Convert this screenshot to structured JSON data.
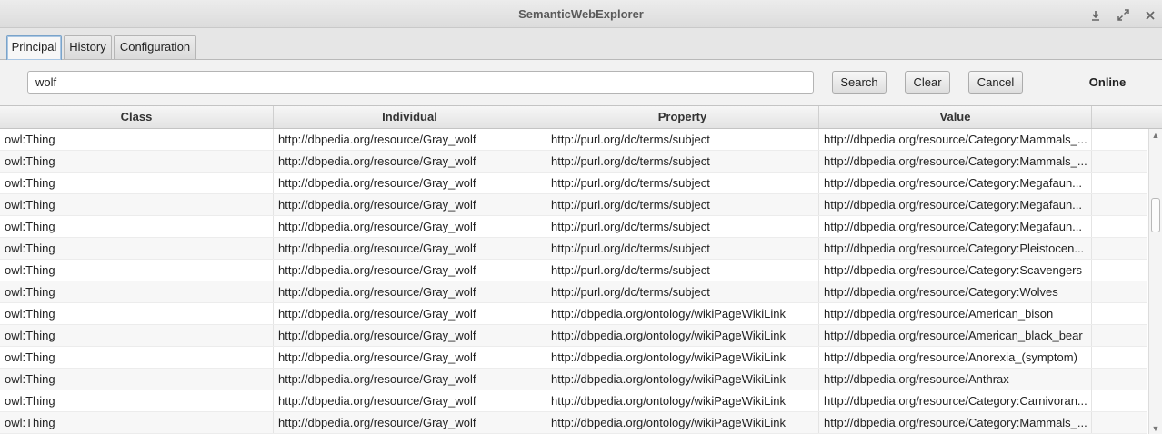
{
  "window": {
    "title": "SemanticWebExplorer",
    "controls": [
      "download-icon",
      "maximize-icon",
      "close-icon"
    ]
  },
  "tabs": [
    {
      "label": "Principal",
      "active": true
    },
    {
      "label": "History",
      "active": false
    },
    {
      "label": "Configuration",
      "active": false
    }
  ],
  "search": {
    "value": "wolf",
    "placeholder": ""
  },
  "buttons": {
    "search": "Search",
    "clear": "Clear",
    "cancel": "Cancel"
  },
  "status": "Online",
  "table": {
    "columns": [
      "Class",
      "Individual",
      "Property",
      "Value"
    ],
    "rows": [
      [
        "owl:Thing",
        "http://dbpedia.org/resource/Gray_wolf",
        "http://purl.org/dc/terms/subject",
        "http://dbpedia.org/resource/Category:Mammals_..."
      ],
      [
        "owl:Thing",
        "http://dbpedia.org/resource/Gray_wolf",
        "http://purl.org/dc/terms/subject",
        "http://dbpedia.org/resource/Category:Mammals_..."
      ],
      [
        "owl:Thing",
        "http://dbpedia.org/resource/Gray_wolf",
        "http://purl.org/dc/terms/subject",
        "http://dbpedia.org/resource/Category:Megafaun..."
      ],
      [
        "owl:Thing",
        "http://dbpedia.org/resource/Gray_wolf",
        "http://purl.org/dc/terms/subject",
        "http://dbpedia.org/resource/Category:Megafaun..."
      ],
      [
        "owl:Thing",
        "http://dbpedia.org/resource/Gray_wolf",
        "http://purl.org/dc/terms/subject",
        "http://dbpedia.org/resource/Category:Megafaun..."
      ],
      [
        "owl:Thing",
        "http://dbpedia.org/resource/Gray_wolf",
        "http://purl.org/dc/terms/subject",
        "http://dbpedia.org/resource/Category:Pleistocen..."
      ],
      [
        "owl:Thing",
        "http://dbpedia.org/resource/Gray_wolf",
        "http://purl.org/dc/terms/subject",
        "http://dbpedia.org/resource/Category:Scavengers"
      ],
      [
        "owl:Thing",
        "http://dbpedia.org/resource/Gray_wolf",
        "http://purl.org/dc/terms/subject",
        "http://dbpedia.org/resource/Category:Wolves"
      ],
      [
        "owl:Thing",
        "http://dbpedia.org/resource/Gray_wolf",
        "http://dbpedia.org/ontology/wikiPageWikiLink",
        "http://dbpedia.org/resource/American_bison"
      ],
      [
        "owl:Thing",
        "http://dbpedia.org/resource/Gray_wolf",
        "http://dbpedia.org/ontology/wikiPageWikiLink",
        "http://dbpedia.org/resource/American_black_bear"
      ],
      [
        "owl:Thing",
        "http://dbpedia.org/resource/Gray_wolf",
        "http://dbpedia.org/ontology/wikiPageWikiLink",
        "http://dbpedia.org/resource/Anorexia_(symptom)"
      ],
      [
        "owl:Thing",
        "http://dbpedia.org/resource/Gray_wolf",
        "http://dbpedia.org/ontology/wikiPageWikiLink",
        "http://dbpedia.org/resource/Anthrax"
      ],
      [
        "owl:Thing",
        "http://dbpedia.org/resource/Gray_wolf",
        "http://dbpedia.org/ontology/wikiPageWikiLink",
        "http://dbpedia.org/resource/Category:Carnivoran..."
      ],
      [
        "owl:Thing",
        "http://dbpedia.org/resource/Gray_wolf",
        "http://dbpedia.org/ontology/wikiPageWikiLink",
        "http://dbpedia.org/resource/Category:Mammals_..."
      ]
    ]
  }
}
